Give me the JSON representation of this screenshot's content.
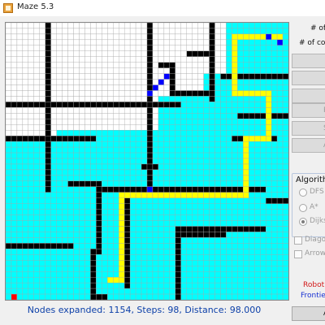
{
  "window": {
    "title": "Maze 5.3",
    "app_icon": "maze-app-icon"
  },
  "colors": {
    "expanded": "#00ffff",
    "wall": "#000000",
    "empty": "#ffffff",
    "path": "#ffff00",
    "frontier": "#0000ff",
    "robot": "#ff0000",
    "grid": "#a6a6a6"
  },
  "controls": {
    "rows_label": "# of",
    "cols_label": "# of colu",
    "buttons": [
      "",
      "",
      "",
      "R",
      "St",
      "A"
    ],
    "algorithm_title": "Algorithm",
    "algorithms": [
      {
        "label": "DFS",
        "selected": false
      },
      {
        "label": "A*",
        "selected": false
      },
      {
        "label": "Dijks",
        "selected": true
      }
    ],
    "diagonal_label": "Diagon",
    "arrows_label": "Arrows",
    "legend_robot": "Robot",
    "legend_frontier": "Frontie",
    "about_button": "A"
  },
  "status": {
    "text": "Nodes expanded: 1154, Steps: 98, Distance: 98.000"
  }
}
